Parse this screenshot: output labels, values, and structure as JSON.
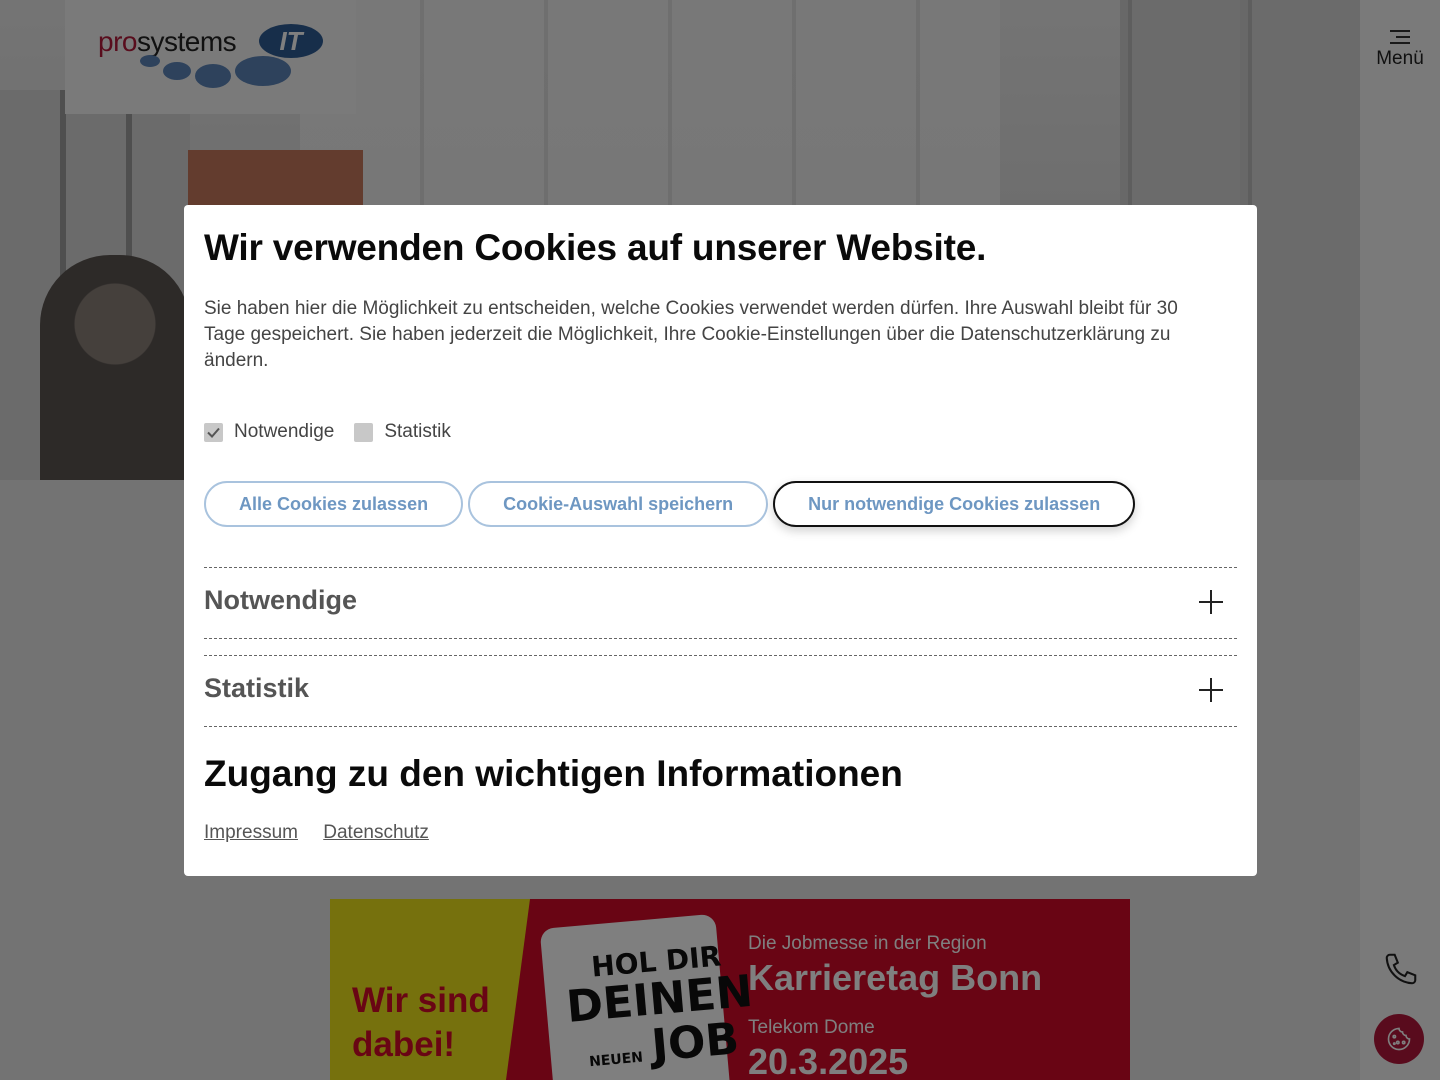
{
  "header": {
    "logo_pro": "pro",
    "logo_systems": "systems",
    "logo_it": "IT",
    "menu_label": "Menü"
  },
  "icons": {
    "menu": "menu-lines-icon",
    "phone": "phone-icon",
    "cookie": "cookie-icon",
    "expand": "plus-icon",
    "check": "checkmark-icon"
  },
  "colors": {
    "brand_red": "#b3163a",
    "button_blue": "#6e97c2",
    "button_border": "#a9c3de"
  },
  "modal": {
    "title": "Wir verwenden Cookies auf unserer Website.",
    "description": "Sie haben hier die Möglichkeit zu entscheiden, welche Cookies verwendet werden dürfen. Ihre Auswahl bleibt für 30 Tage gespeichert. Sie haben jederzeit die Möglichkeit, Ihre Cookie-Einstellungen über die Datenschutzerklärung zu ändern.",
    "checkboxes": [
      {
        "label": "Notwendige",
        "checked": true,
        "disabled": true
      },
      {
        "label": "Statistik",
        "checked": false
      }
    ],
    "buttons": {
      "accept_all": "Alle Cookies zulassen",
      "save_selection": "Cookie-Auswahl speichern",
      "necessary_only": "Nur notwendige Cookies zulassen"
    },
    "accordions": [
      {
        "label": "Notwendige"
      },
      {
        "label": "Statistik"
      }
    ],
    "subtitle": "Zugang zu den wichtigen Informationen",
    "links": {
      "imprint": "Impressum",
      "privacy": "Datenschutz"
    }
  },
  "banner": {
    "left_text_1": "Wir sind",
    "left_text_2": "dabei!",
    "card_line1": "HOL DIR",
    "card_line2": "DEINEN",
    "card_small": "NEUEN",
    "card_line3": "JOB",
    "subtitle": "Die Jobmesse in der Region",
    "title": "Karrieretag Bonn",
    "venue": "Telekom Dome",
    "date": "20.3.2025"
  }
}
